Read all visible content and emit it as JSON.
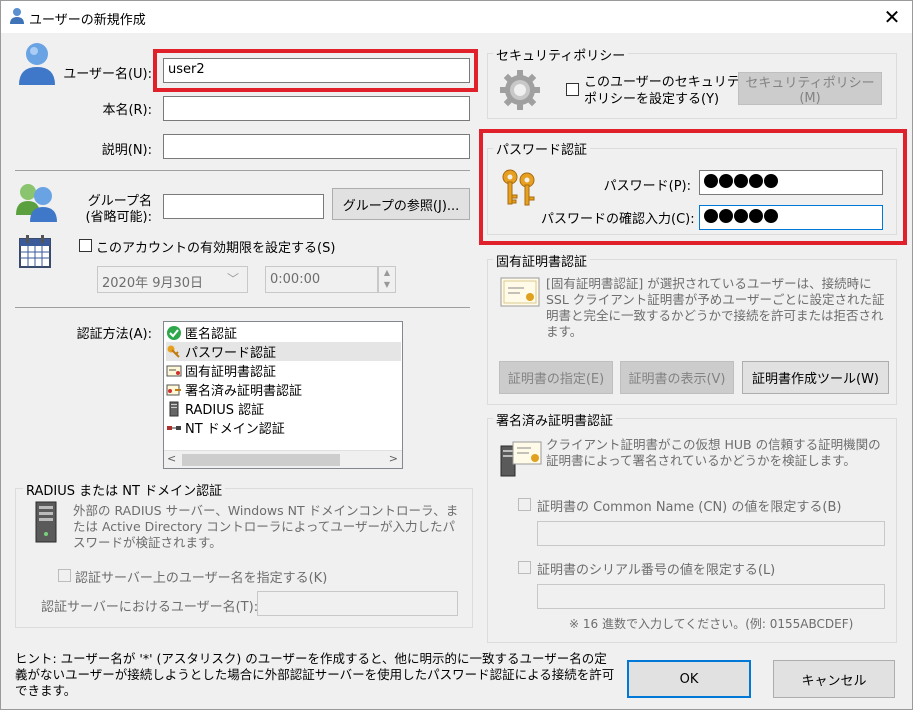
{
  "window": {
    "title": "ユーザーの新規作成",
    "close": "✕"
  },
  "user": {
    "username_label": "ユーザー名(U):",
    "username_value": "user2",
    "realname_label": "本名(R):",
    "realname_value": "",
    "note_label": "説明(N):",
    "note_value": ""
  },
  "group": {
    "label1": "グループ名",
    "label2": "(省略可能):",
    "value": "",
    "browse_button": "グループの参照(J)..."
  },
  "expire": {
    "checkbox_label": "このアカウントの有効期限を設定する(S)",
    "date": "2020年  9月30日",
    "time": "0:00:00"
  },
  "auth": {
    "label": "認証方法(A):",
    "items": [
      {
        "label": "匿名認証",
        "selected": false
      },
      {
        "label": "パスワード認証",
        "selected": true
      },
      {
        "label": "固有証明書認証",
        "selected": false
      },
      {
        "label": "署名済み証明書認証",
        "selected": false
      },
      {
        "label": "RADIUS 認証",
        "selected": false
      },
      {
        "label": "NT ドメイン認証",
        "selected": false
      }
    ]
  },
  "radius": {
    "group_title": "RADIUS または NT ドメイン認証",
    "desc": "外部の RADIUS サーバー、Windows NT ドメインコントローラ、または Active Directory コントローラによってユーザーが入力したパスワードが検証されます。",
    "checkbox_label": "認証サーバー上のユーザー名を指定する(K)",
    "name_label": "認証サーバーにおけるユーザー名(T):",
    "name_value": ""
  },
  "security": {
    "group_title": "セキュリティポリシー",
    "checkbox_line1": "このユーザーのセキュリティ",
    "checkbox_line2": "ポリシーを設定する(Y)",
    "button": "セキュリティポリシー(M)"
  },
  "password": {
    "group_title": "パスワード認証",
    "password_label": "パスワード(P):",
    "confirm_label": "パスワードの確認入力(C):",
    "password_mask_count": 5,
    "confirm_mask_count": 5
  },
  "cert": {
    "group_title": "固有証明書認証",
    "desc": "[固有証明書認証] が選択されているユーザーは、接続時に SSL クライアント証明書が予めユーザーごとに設定された証明書と完全に一致するかどうかで接続を許可または拒否されます。",
    "specify_button": "証明書の指定(E)",
    "view_button": "証明書の表示(V)",
    "tool_button": "証明書作成ツール(W)"
  },
  "signed": {
    "group_title": "署名済み証明書認証",
    "desc": "クライアント証明書がこの仮想 HUB の信頼する証明機関の証明書によって署名されているかどうかを検証します。",
    "cn_checkbox": "証明書の Common Name (CN) の値を限定する(B)",
    "cn_value": "",
    "serial_checkbox": "証明書のシリアル番号の値を限定する(L)",
    "serial_value": "",
    "hint": "※ 16 進数で入力してください。(例: 0155ABCDEF)"
  },
  "hint": "ヒント: ユーザー名が '*' (アスタリスク) のユーザーを作成すると、他に明示的に一致するユーザー名の定義がないユーザーが接続しようとした場合に外部認証サーバーを使用したパスワード認証による接続を許可できます。",
  "buttons": {
    "ok": "OK",
    "cancel": "キャンセル"
  },
  "colors": {
    "highlight": "#e0202a",
    "accent_focus": "#0078d7"
  }
}
